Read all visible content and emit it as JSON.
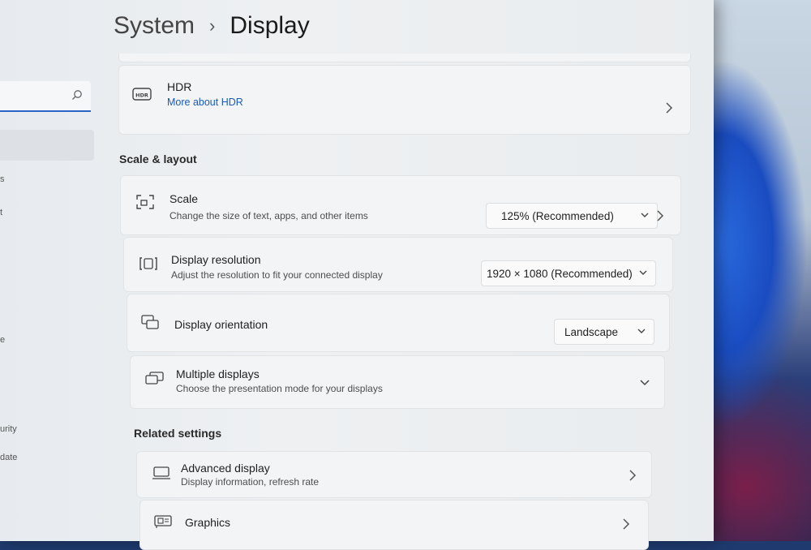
{
  "breadcrumb": {
    "parent": "System",
    "separator": "›",
    "current": "Display"
  },
  "left_nav": {
    "fragments": [
      "s",
      "t",
      "e",
      "urity",
      "date"
    ]
  },
  "hdr": {
    "title": "HDR",
    "link": "More about HDR"
  },
  "sections": {
    "scale_layout": "Scale & layout",
    "related": "Related settings"
  },
  "scale": {
    "title": "Scale",
    "subtitle": "Change the size of text, apps, and other items",
    "value": "125% (Recommended)"
  },
  "resolution": {
    "title": "Display resolution",
    "subtitle": "Adjust the resolution to fit your connected display",
    "value": "1920 × 1080 (Recommended)"
  },
  "orientation": {
    "title": "Display orientation",
    "value": "Landscape"
  },
  "multiple": {
    "title": "Multiple displays",
    "subtitle": "Choose the presentation mode for your displays"
  },
  "advanced": {
    "title": "Advanced display",
    "subtitle": "Display information, refresh rate"
  },
  "graphics": {
    "title": "Graphics"
  },
  "colors": {
    "accent": "#1a5bb5",
    "card": "#f3f4f5",
    "window": "#eceef0"
  }
}
